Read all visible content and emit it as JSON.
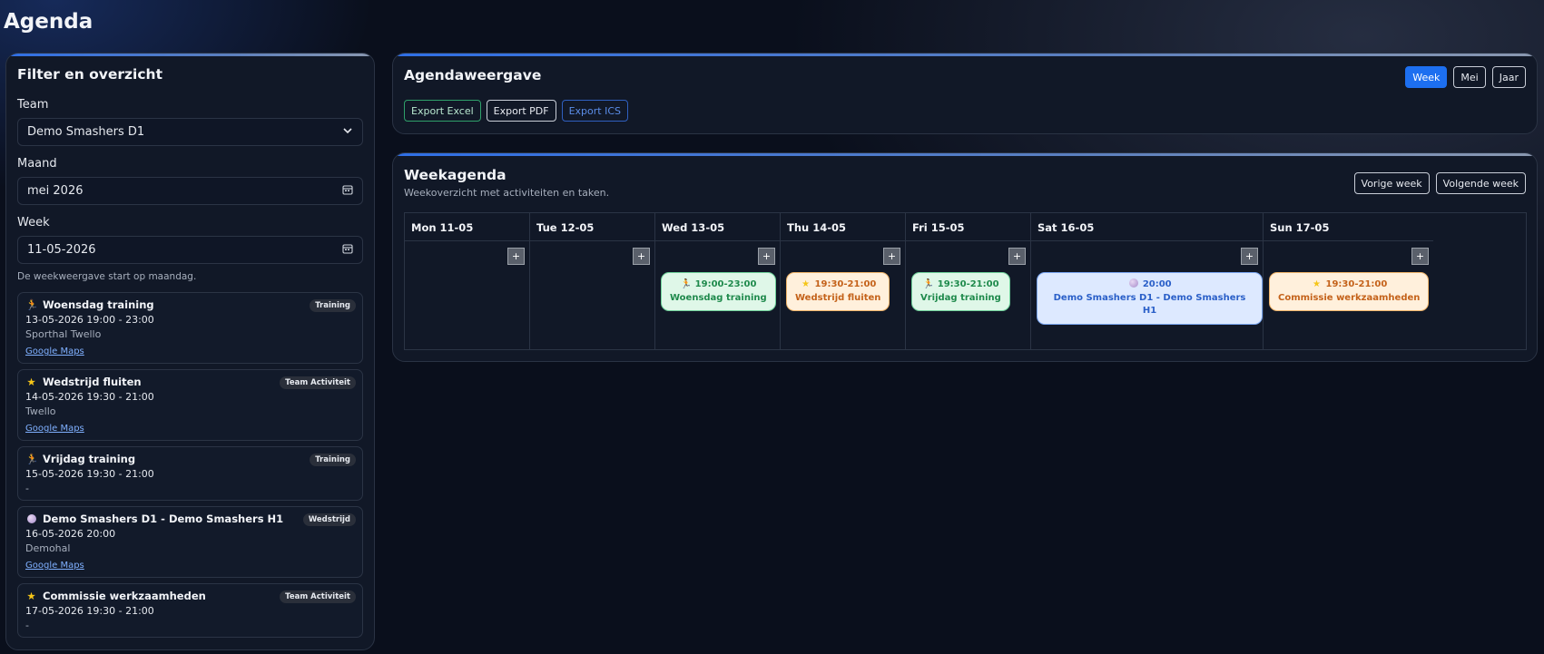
{
  "page": {
    "title": "Agenda"
  },
  "filter": {
    "title": "Filter en overzicht",
    "team_label": "Team",
    "team_value": "Demo Smashers D1",
    "month_label": "Maand",
    "month_value": "mei 2026",
    "week_label": "Week",
    "week_value": "11-05-2026",
    "help": "De weekweergave start op maandag."
  },
  "events": [
    {
      "title": "Woensdag training",
      "badge": "Training",
      "datetime": "13-05-2026 19:00 - 23:00",
      "location": "Sporthal Twello",
      "link": "Google Maps",
      "icon": "runner-icon"
    },
    {
      "title": "Wedstrijd fluiten",
      "badge": "Team Activiteit",
      "datetime": "14-05-2026 19:30 - 21:00",
      "location": "Twello",
      "link": "Google Maps",
      "icon": "star-icon"
    },
    {
      "title": "Vrijdag training",
      "badge": "Training",
      "datetime": "15-05-2026 19:30 - 21:00",
      "location": "-",
      "link": "",
      "icon": "runner-icon"
    },
    {
      "title": "Demo Smashers D1 - Demo Smashers H1",
      "badge": "Wedstrijd",
      "datetime": "16-05-2026 20:00",
      "location": "Demohal",
      "link": "Google Maps",
      "icon": "volleyball-icon"
    },
    {
      "title": "Commissie werkzaamheden",
      "badge": "Team Activiteit",
      "datetime": "17-05-2026 19:30 - 21:00",
      "location": "-",
      "link": "",
      "icon": "star-icon"
    }
  ],
  "view": {
    "title": "Agendaweergave",
    "export_excel": "Export Excel",
    "export_pdf": "Export PDF",
    "export_ics": "Export ICS",
    "modes": [
      "Week",
      "Mei",
      "Jaar"
    ],
    "active_mode": "Week"
  },
  "week": {
    "title": "Weekagenda",
    "subtitle": "Weekoverzicht met activiteiten en taken.",
    "prev": "Vorige week",
    "next": "Volgende week",
    "add_label": "+",
    "days": [
      {
        "label": "Mon 11-05",
        "chip": null
      },
      {
        "label": "Tue 12-05",
        "chip": null
      },
      {
        "label": "Wed 13-05",
        "chip": {
          "time": "19:00-23:00",
          "title": "Woensdag training",
          "kind": "training"
        }
      },
      {
        "label": "Thu 14-05",
        "chip": {
          "time": "19:30-21:00",
          "title": "Wedstrijd fluiten",
          "kind": "activity"
        }
      },
      {
        "label": "Fri 15-05",
        "chip": {
          "time": "19:30-21:00",
          "title": "Vrijdag training",
          "kind": "training"
        }
      },
      {
        "label": "Sat 16-05",
        "chip": {
          "time": "20:00",
          "title": "Demo Smashers D1 - Demo Smashers H1",
          "kind": "match"
        }
      },
      {
        "label": "Sun 17-05",
        "chip": {
          "time": "19:30-21:00",
          "title": "Commissie werkzaamheden",
          "kind": "activity"
        }
      }
    ]
  },
  "colors": {
    "accent": "#1d6ff0",
    "training": "#1f8a4c",
    "activity": "#c4621a",
    "match": "#2a5fc8"
  }
}
